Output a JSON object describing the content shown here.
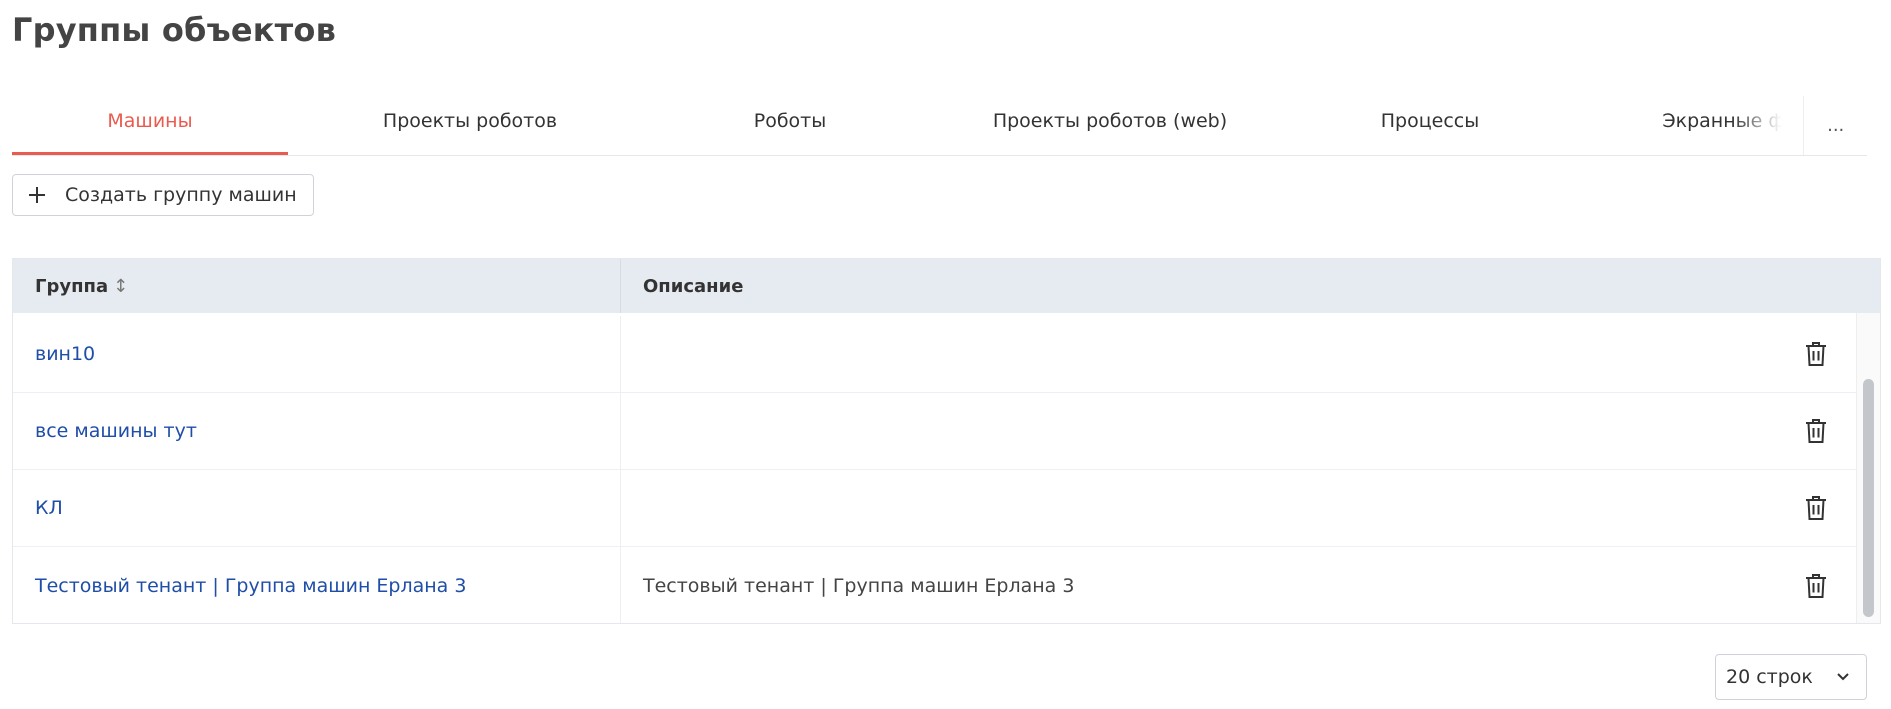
{
  "page": {
    "title": "Группы объектов"
  },
  "tabs": [
    {
      "label": "Машины",
      "active": true
    },
    {
      "label": "Проекты роботов",
      "active": false
    },
    {
      "label": "Роботы",
      "active": false
    },
    {
      "label": "Проекты роботов (web)",
      "active": false
    },
    {
      "label": "Процессы",
      "active": false
    },
    {
      "label": "Экранные формы",
      "active": false
    }
  ],
  "tabs_more_label": "...",
  "toolbar": {
    "create_label": "Создать группу машин"
  },
  "table": {
    "columns": {
      "group": "Группа",
      "description": "Описание"
    },
    "sort_icon": "↕",
    "rows": [
      {
        "group": "вин10",
        "description": ""
      },
      {
        "group": "все машины тут",
        "description": ""
      },
      {
        "group": "КЛ",
        "description": ""
      },
      {
        "group": "Тестовый тенант | Группа машин Ерлана 3",
        "description": "Тестовый тенант | Группа машин Ерлана 3"
      }
    ]
  },
  "pagination": {
    "rows_per_page": "20 строк"
  },
  "colors": {
    "accent": "#ea5a4f",
    "link": "#1f4ea8",
    "header_bg": "#e6eaf1"
  },
  "icons": {
    "create": "plus-icon",
    "delete": "trash-icon",
    "sort": "sort-icon",
    "select": "chevron-down-icon"
  }
}
